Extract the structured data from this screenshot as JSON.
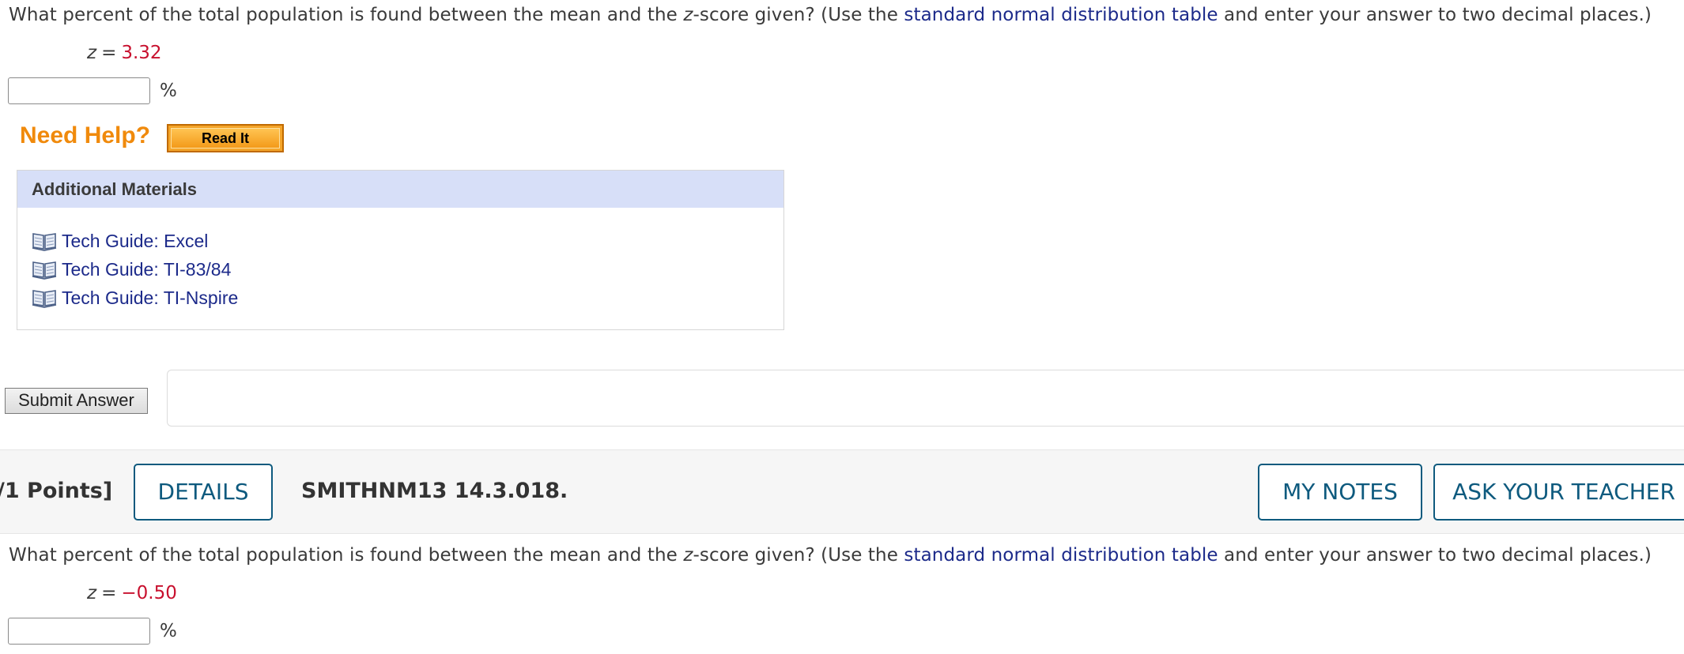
{
  "question1": {
    "text_before": "What percent of the total population is found between the mean and the ",
    "z_italic": "z",
    "text_middle": "-score given? (Use the ",
    "table_link": "standard normal distribution table",
    "text_after": " and enter your answer to two decimal places.)",
    "z_var": "z",
    "equals": "=",
    "z_value": "3.32",
    "answer_value": "",
    "unit": "%"
  },
  "help": {
    "label": "Need Help?",
    "read_it_label": "Read It"
  },
  "additional_materials": {
    "title": "Additional Materials",
    "items": [
      {
        "label": "Tech Guide: Excel",
        "icon": "book-icon"
      },
      {
        "label": "Tech Guide: TI-83/84",
        "icon": "book-icon"
      },
      {
        "label": "Tech Guide: TI-Nspire",
        "icon": "book-icon"
      }
    ]
  },
  "submit": {
    "label": "Submit Answer"
  },
  "question_bar": {
    "points_label": "/1 Points]",
    "details_label": "DETAILS",
    "question_id": "SMITHNM13 14.3.018.",
    "my_notes_label": "MY NOTES",
    "ask_teacher_label": "ASK YOUR TEACHER"
  },
  "question2": {
    "text_before": "What percent of the total population is found between the mean and the ",
    "z_italic": "z",
    "text_middle": "-score given? (Use the ",
    "table_link": "standard normal distribution table",
    "text_after": " and enter your answer to two decimal places.)",
    "z_var": "z",
    "equals": "=",
    "z_value": "−0.50",
    "answer_value": "",
    "unit": "%"
  },
  "colors": {
    "link": "#1c2a8a",
    "z_value": "#c8102e",
    "need_help": "#f08a0c",
    "materials_header": "#d7dff8",
    "bar_button": "#0e5a7e"
  }
}
